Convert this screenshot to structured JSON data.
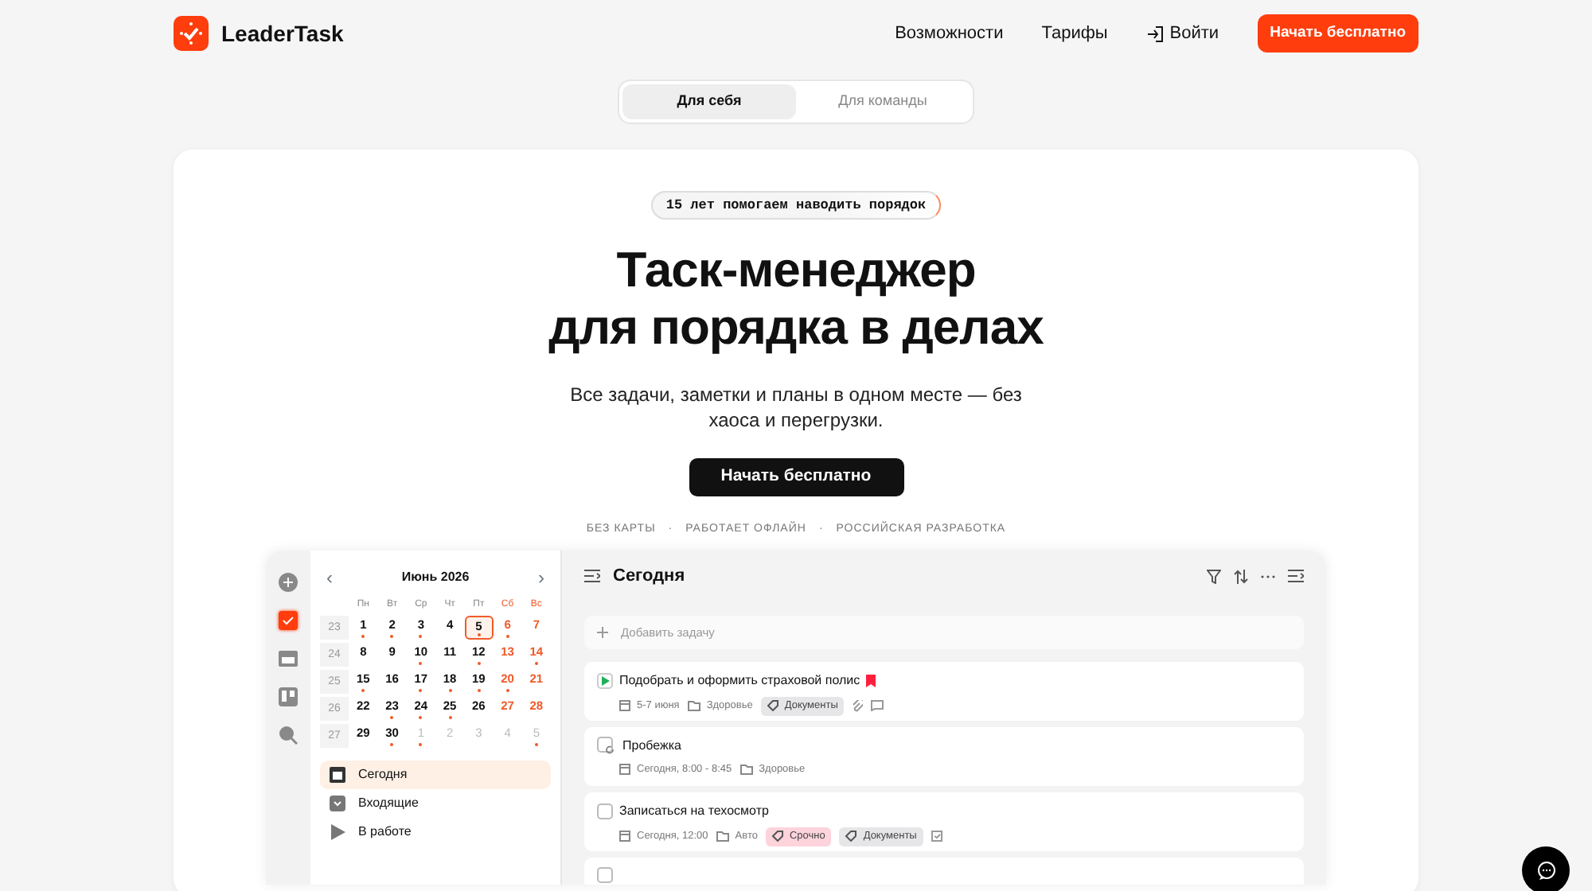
{
  "header": {
    "brand": "LeaderTask",
    "nav": [
      {
        "label": "Возможности",
        "kind": "link"
      },
      {
        "label": "Тарифы",
        "kind": "link"
      },
      {
        "label": "Войти",
        "kind": "login"
      }
    ],
    "cta": "Начать бесплатно"
  },
  "audience_tabs": [
    {
      "label": "Для себя",
      "selected": true
    },
    {
      "label": "Для команды",
      "selected": false
    }
  ],
  "hero": {
    "badge": "15 лет помогаем наводить порядок",
    "title_lines": [
      "Таск-менеджер",
      "для порядка в делах"
    ],
    "subtitle": "Все задачи, заметки и планы в одном месте — без хаоса и перегрузки.",
    "button": "Начать бесплатно",
    "perk_separator": "·",
    "perks": [
      "БЕЗ КАРТЫ",
      "РАБОТАЕТ ОФЛАЙН",
      "РОССИЙСКАЯ РАЗРАБОТКА"
    ]
  },
  "app": {
    "rail": [
      {
        "kind": "add",
        "selected": false
      },
      {
        "kind": "tasks",
        "selected": true
      },
      {
        "kind": "calendar",
        "selected": false
      },
      {
        "kind": "board",
        "selected": false
      },
      {
        "kind": "search",
        "selected": false
      }
    ],
    "calendar": {
      "prev": "‹",
      "month": "Июнь 2026",
      "next": "›",
      "weekdays": [
        {
          "label": "Пн",
          "weekend": false
        },
        {
          "label": "Вт",
          "weekend": false
        },
        {
          "label": "Ср",
          "weekend": false
        },
        {
          "label": "Чт",
          "weekend": false
        },
        {
          "label": "Пт",
          "weekend": false
        },
        {
          "label": "Сб",
          "weekend": true
        },
        {
          "label": "Вс",
          "weekend": true
        }
      ],
      "weeks": [
        {
          "number": "23",
          "days": [
            {
              "day": "1",
              "dot": true,
              "muted": false,
              "selected": false
            },
            {
              "day": "2",
              "dot": true,
              "muted": false,
              "selected": false
            },
            {
              "day": "3",
              "dot": true,
              "muted": false,
              "selected": false
            },
            {
              "day": "4",
              "dot": false,
              "muted": false,
              "selected": false
            },
            {
              "day": "5",
              "dot": true,
              "muted": false,
              "selected": true
            },
            {
              "day": "6",
              "dot": true,
              "muted": false,
              "selected": false
            },
            {
              "day": "7",
              "dot": false,
              "muted": false,
              "selected": false
            }
          ]
        },
        {
          "number": "24",
          "days": [
            {
              "day": "8",
              "dot": false,
              "muted": false,
              "selected": false
            },
            {
              "day": "9",
              "dot": false,
              "muted": false,
              "selected": false
            },
            {
              "day": "10",
              "dot": true,
              "muted": false,
              "selected": false
            },
            {
              "day": "11",
              "dot": false,
              "muted": false,
              "selected": false
            },
            {
              "day": "12",
              "dot": true,
              "muted": false,
              "selected": false
            },
            {
              "day": "13",
              "dot": false,
              "muted": false,
              "selected": false
            },
            {
              "day": "14",
              "dot": true,
              "muted": false,
              "selected": false
            }
          ]
        },
        {
          "number": "25",
          "days": [
            {
              "day": "15",
              "dot": true,
              "muted": false,
              "selected": false
            },
            {
              "day": "16",
              "dot": false,
              "muted": false,
              "selected": false
            },
            {
              "day": "17",
              "dot": true,
              "muted": false,
              "selected": false
            },
            {
              "day": "18",
              "dot": true,
              "muted": false,
              "selected": false
            },
            {
              "day": "19",
              "dot": true,
              "muted": false,
              "selected": false
            },
            {
              "day": "20",
              "dot": true,
              "muted": false,
              "selected": false
            },
            {
              "day": "21",
              "dot": false,
              "muted": false,
              "selected": false
            }
          ]
        },
        {
          "number": "26",
          "days": [
            {
              "day": "22",
              "dot": false,
              "muted": false,
              "selected": false
            },
            {
              "day": "23",
              "dot": true,
              "muted": false,
              "selected": false
            },
            {
              "day": "24",
              "dot": true,
              "muted": false,
              "selected": false
            },
            {
              "day": "25",
              "dot": true,
              "muted": false,
              "selected": false
            },
            {
              "day": "26",
              "dot": false,
              "muted": false,
              "selected": false
            },
            {
              "day": "27",
              "dot": false,
              "muted": false,
              "selected": false
            },
            {
              "day": "28",
              "dot": false,
              "muted": false,
              "selected": false
            }
          ]
        },
        {
          "number": "27",
          "days": [
            {
              "day": "29",
              "dot": false,
              "muted": false,
              "selected": false
            },
            {
              "day": "30",
              "dot": true,
              "muted": false,
              "selected": false
            },
            {
              "day": "1",
              "dot": true,
              "muted": true,
              "selected": false
            },
            {
              "day": "2",
              "dot": false,
              "muted": true,
              "selected": false
            },
            {
              "day": "3",
              "dot": false,
              "muted": true,
              "selected": false
            },
            {
              "day": "4",
              "dot": false,
              "muted": true,
              "selected": false
            },
            {
              "day": "5",
              "dot": true,
              "muted": true,
              "selected": false
            }
          ]
        }
      ]
    },
    "menu": [
      {
        "label": "Сегодня",
        "kind": "today",
        "selected": true
      },
      {
        "label": "Входящие",
        "kind": "inbox",
        "selected": false
      },
      {
        "label": "В работе",
        "kind": "play",
        "selected": false
      }
    ],
    "list": {
      "title": "Сегодня",
      "add_placeholder": "Добавить задачу",
      "tasks": [
        {
          "title": "Подобрать и оформить страховой полис",
          "kind": "play",
          "checked": false,
          "flag": true,
          "meta": [
            {
              "kind": "date",
              "text": "5-7 июня"
            },
            {
              "kind": "folder",
              "text": "Здоровье"
            },
            {
              "kind": "tag",
              "text": "Документы",
              "color": "#e6e6e8"
            },
            {
              "kind": "attachment"
            },
            {
              "kind": "comment"
            }
          ]
        },
        {
          "title": "Пробежка",
          "kind": "repeat",
          "checked": false,
          "flag": false,
          "meta": [
            {
              "kind": "date",
              "text": "Сегодня, 8:00 - 8:45"
            },
            {
              "kind": "folder",
              "text": "Здоровье"
            }
          ]
        },
        {
          "title": "Записаться на техосмотр",
          "kind": "open",
          "checked": false,
          "flag": false,
          "meta": [
            {
              "kind": "date",
              "text": "Сегодня, 12:00"
            },
            {
              "kind": "folder",
              "text": "Авто"
            },
            {
              "kind": "tag",
              "text": "Срочно",
              "color": "#fdd3dc"
            },
            {
              "kind": "tag",
              "text": "Документы",
              "color": "#e6e6e8"
            },
            {
              "kind": "subtask"
            }
          ]
        },
        {
          "kind": "open",
          "checked": false
        }
      ]
    }
  }
}
